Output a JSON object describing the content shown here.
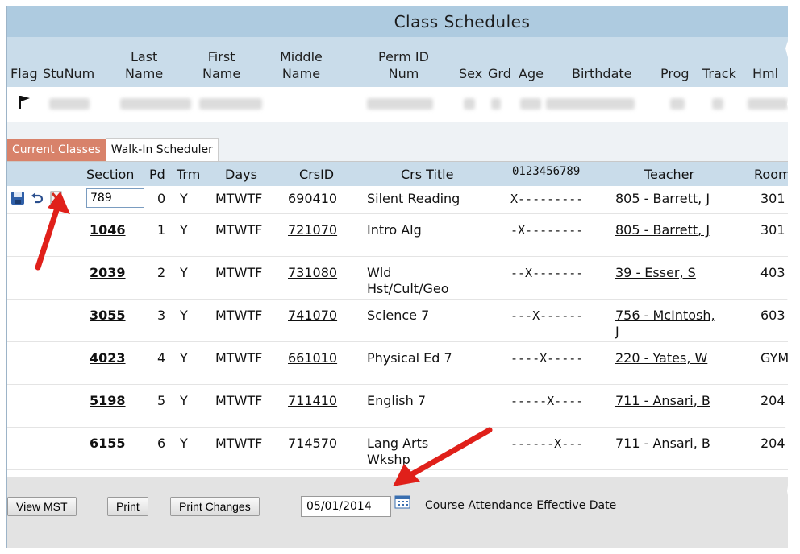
{
  "header": {
    "title": "Class Schedules"
  },
  "student_columns": [
    {
      "key": "flag",
      "label": "Flag"
    },
    {
      "key": "stunum",
      "label": "StuNum"
    },
    {
      "key": "last",
      "label": "Last\nName"
    },
    {
      "key": "first",
      "label": "First\nName"
    },
    {
      "key": "middle",
      "label": "Middle\nName"
    },
    {
      "key": "permid",
      "label": "Perm ID\nNum"
    },
    {
      "key": "sex",
      "label": "Sex"
    },
    {
      "key": "grd",
      "label": "Grd"
    },
    {
      "key": "age",
      "label": "Age"
    },
    {
      "key": "birthdate",
      "label": "Birthdate"
    },
    {
      "key": "prog",
      "label": "Prog"
    },
    {
      "key": "track",
      "label": "Track"
    },
    {
      "key": "hml",
      "label": "Hml"
    }
  ],
  "tabs": [
    {
      "label": "Current Classes",
      "active": true
    },
    {
      "label": "Walk-In Scheduler",
      "active": false
    }
  ],
  "class_columns": {
    "section": "Section",
    "pd": "Pd",
    "trm": "Trm",
    "days": "Days",
    "crsid": "CrsID",
    "title": "Crs Title",
    "periods": "0123456789",
    "teacher": "Teacher",
    "room": "Room"
  },
  "rows": [
    {
      "section": "789",
      "pd": "0",
      "trm": "Y",
      "days": "MTWTF",
      "crsid": "690410",
      "title": "Silent Reading",
      "pattern": "X---------",
      "teacher": "805 - Barrett, J",
      "room": "301",
      "editing": true
    },
    {
      "section": "1046",
      "pd": "1",
      "trm": "Y",
      "days": "MTWTF",
      "crsid": "721070",
      "title": "Intro Alg",
      "pattern": "-X--------",
      "teacher": "805 - Barrett, J",
      "room": "301"
    },
    {
      "section": "2039",
      "pd": "2",
      "trm": "Y",
      "days": "MTWTF",
      "crsid": "731080",
      "title": "Wld\nHst/Cult/Geo",
      "pattern": "--X-------",
      "teacher": "39 - Esser, S",
      "room": "403"
    },
    {
      "section": "3055",
      "pd": "3",
      "trm": "Y",
      "days": "MTWTF",
      "crsid": "741070",
      "title": "Science 7",
      "pattern": "---X------",
      "teacher": "756 - McIntosh,\nJ",
      "room": "603"
    },
    {
      "section": "4023",
      "pd": "4",
      "trm": "Y",
      "days": "MTWTF",
      "crsid": "661010",
      "title": "Physical Ed 7",
      "pattern": "----X-----",
      "teacher": "220 - Yates, W",
      "room": "GYM"
    },
    {
      "section": "5198",
      "pd": "5",
      "trm": "Y",
      "days": "MTWTF",
      "crsid": "711410",
      "title": "English 7",
      "pattern": "-----X----",
      "teacher": "711 - Ansari, B",
      "room": "204"
    },
    {
      "section": "6155",
      "pd": "6",
      "trm": "Y",
      "days": "MTWTF",
      "crsid": "714570",
      "title": "Lang Arts\nWkshp",
      "pattern": "------X---",
      "teacher": "711 - Ansari, B",
      "room": "204"
    }
  ],
  "footer": {
    "view_mst": "View MST",
    "print": "Print",
    "print_changes": "Print Changes",
    "date": "05/01/2014",
    "effective_label": "Course Attendance Effective Date"
  },
  "colors": {
    "header": "#aecbe0",
    "subheader": "#c9dcea",
    "active_tab": "#d8826a",
    "arrow": "#e0201a"
  },
  "icons": [
    "flag-icon",
    "save-icon",
    "undo-icon",
    "delete-icon",
    "calendar-icon"
  ]
}
